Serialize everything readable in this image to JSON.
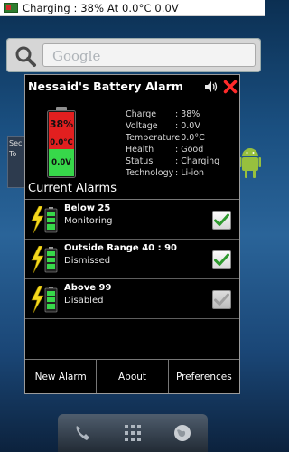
{
  "status_bar": {
    "text": "Charging : 38% At 0.0°C 0.0V"
  },
  "homescreen": {
    "search_placeholder": "Google",
    "side_widget_text": "Sec\nTo"
  },
  "dialog": {
    "title": "Nessaid's Battery Alarm",
    "battery": {
      "percent": "38%",
      "temperature": "0.0°C",
      "voltage": "0.0V",
      "fill_fraction": 0.38
    },
    "info": [
      {
        "key": "Charge",
        "value": ": 38%"
      },
      {
        "key": "Voltage",
        "value": ": 0.0V"
      },
      {
        "key": "Temperature",
        "value": ": 0.0°C"
      },
      {
        "key": "Health",
        "value": ": Good"
      },
      {
        "key": "Status",
        "value": ": Charging"
      },
      {
        "key": "Technology",
        "value": ": Li-ion"
      }
    ],
    "section_title": "Current Alarms",
    "alarms": [
      {
        "title": "Below 25",
        "status": "Monitoring",
        "checked": true,
        "enabled": true
      },
      {
        "title": "Outside Range 40 : 90",
        "status": "Dismissed",
        "checked": true,
        "enabled": true
      },
      {
        "title": "Above 99",
        "status": "Disabled",
        "checked": true,
        "enabled": false
      }
    ],
    "buttons": {
      "new_alarm": "New Alarm",
      "about": "About",
      "preferences": "Preferences"
    }
  },
  "colors": {
    "accent_green": "#2f8f2f",
    "battery_red": "#e21f1f",
    "battery_green": "#37d84a",
    "close_red": "#ff2a2a"
  }
}
